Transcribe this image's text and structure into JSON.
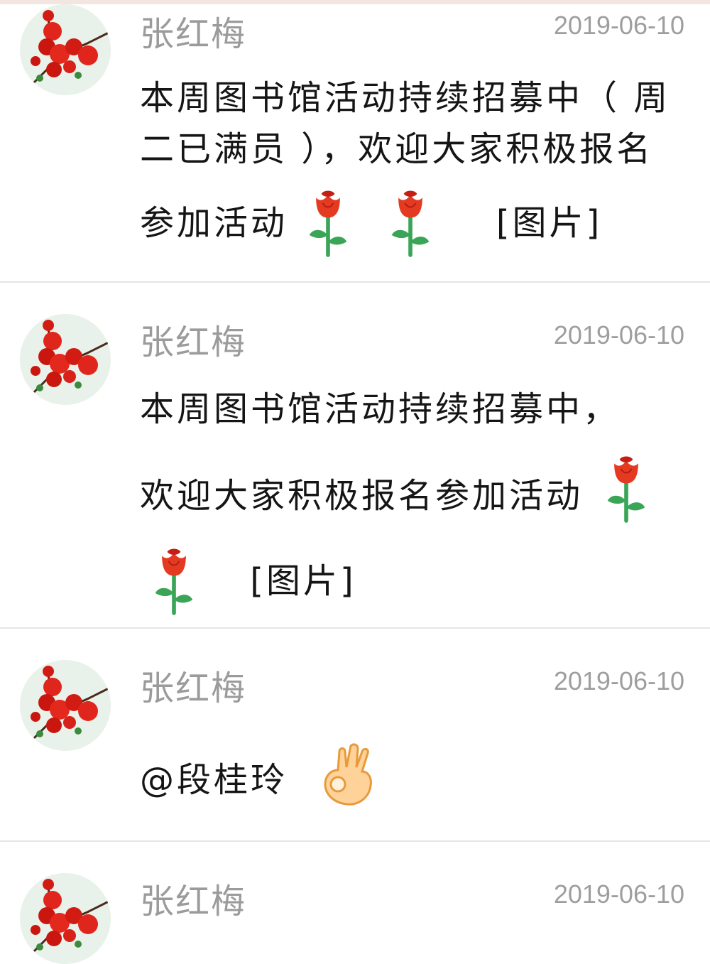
{
  "messages": [
    {
      "sender": "张红梅",
      "time": "2019-06-10",
      "lines": [
        "本周图书馆活动持续招募中（ 周",
        "二已满员 ），欢迎大家积极报名",
        "参加活动"
      ],
      "image_tag": "[图片]",
      "emojis": [
        "rose-icon",
        "rose-icon"
      ]
    },
    {
      "sender": "张红梅",
      "time": "2019-06-10",
      "lines": [
        "本周图书馆活动持续招募中，",
        "欢迎大家积极报名参加活动"
      ],
      "image_tag": "[图片]",
      "emojis": [
        "rose-icon",
        "rose-icon"
      ]
    },
    {
      "sender": "张红梅",
      "time": "2019-06-10",
      "mention": "@段桂玲",
      "emojis": [
        "ok-hand-icon"
      ]
    },
    {
      "sender": "张红梅",
      "time": "2019-06-10"
    }
  ],
  "colors": {
    "sender": "#9b9b9b",
    "time": "#9e9e9e",
    "text": "#151515",
    "divider": "#e6e6e6",
    "avatar_bg": "#e9f2ea",
    "flower": "#e0261c"
  }
}
